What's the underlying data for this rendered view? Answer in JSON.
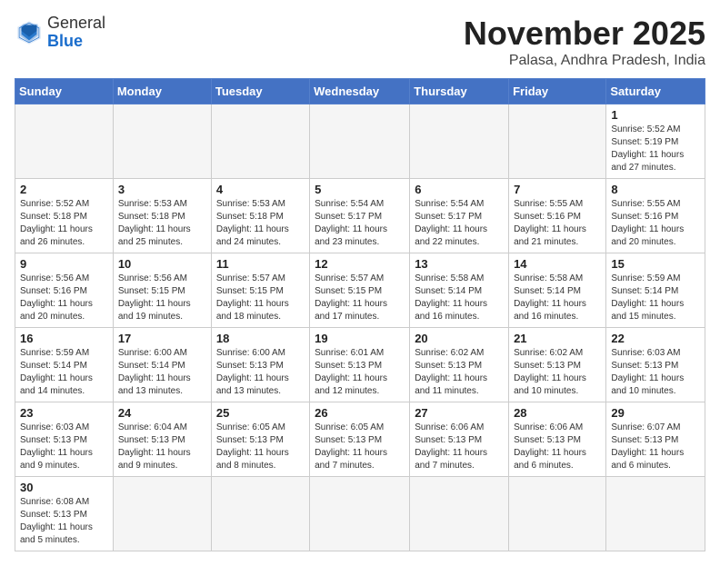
{
  "header": {
    "logo_general": "General",
    "logo_blue": "Blue",
    "month_title": "November 2025",
    "location": "Palasa, Andhra Pradesh, India"
  },
  "weekdays": [
    "Sunday",
    "Monday",
    "Tuesday",
    "Wednesday",
    "Thursday",
    "Friday",
    "Saturday"
  ],
  "weeks": [
    [
      {
        "day": "",
        "info": ""
      },
      {
        "day": "",
        "info": ""
      },
      {
        "day": "",
        "info": ""
      },
      {
        "day": "",
        "info": ""
      },
      {
        "day": "",
        "info": ""
      },
      {
        "day": "",
        "info": ""
      },
      {
        "day": "1",
        "info": "Sunrise: 5:52 AM\nSunset: 5:19 PM\nDaylight: 11 hours and 27 minutes."
      }
    ],
    [
      {
        "day": "2",
        "info": "Sunrise: 5:52 AM\nSunset: 5:18 PM\nDaylight: 11 hours and 26 minutes."
      },
      {
        "day": "3",
        "info": "Sunrise: 5:53 AM\nSunset: 5:18 PM\nDaylight: 11 hours and 25 minutes."
      },
      {
        "day": "4",
        "info": "Sunrise: 5:53 AM\nSunset: 5:18 PM\nDaylight: 11 hours and 24 minutes."
      },
      {
        "day": "5",
        "info": "Sunrise: 5:54 AM\nSunset: 5:17 PM\nDaylight: 11 hours and 23 minutes."
      },
      {
        "day": "6",
        "info": "Sunrise: 5:54 AM\nSunset: 5:17 PM\nDaylight: 11 hours and 22 minutes."
      },
      {
        "day": "7",
        "info": "Sunrise: 5:55 AM\nSunset: 5:16 PM\nDaylight: 11 hours and 21 minutes."
      },
      {
        "day": "8",
        "info": "Sunrise: 5:55 AM\nSunset: 5:16 PM\nDaylight: 11 hours and 20 minutes."
      }
    ],
    [
      {
        "day": "9",
        "info": "Sunrise: 5:56 AM\nSunset: 5:16 PM\nDaylight: 11 hours and 20 minutes."
      },
      {
        "day": "10",
        "info": "Sunrise: 5:56 AM\nSunset: 5:15 PM\nDaylight: 11 hours and 19 minutes."
      },
      {
        "day": "11",
        "info": "Sunrise: 5:57 AM\nSunset: 5:15 PM\nDaylight: 11 hours and 18 minutes."
      },
      {
        "day": "12",
        "info": "Sunrise: 5:57 AM\nSunset: 5:15 PM\nDaylight: 11 hours and 17 minutes."
      },
      {
        "day": "13",
        "info": "Sunrise: 5:58 AM\nSunset: 5:14 PM\nDaylight: 11 hours and 16 minutes."
      },
      {
        "day": "14",
        "info": "Sunrise: 5:58 AM\nSunset: 5:14 PM\nDaylight: 11 hours and 16 minutes."
      },
      {
        "day": "15",
        "info": "Sunrise: 5:59 AM\nSunset: 5:14 PM\nDaylight: 11 hours and 15 minutes."
      }
    ],
    [
      {
        "day": "16",
        "info": "Sunrise: 5:59 AM\nSunset: 5:14 PM\nDaylight: 11 hours and 14 minutes."
      },
      {
        "day": "17",
        "info": "Sunrise: 6:00 AM\nSunset: 5:14 PM\nDaylight: 11 hours and 13 minutes."
      },
      {
        "day": "18",
        "info": "Sunrise: 6:00 AM\nSunset: 5:13 PM\nDaylight: 11 hours and 13 minutes."
      },
      {
        "day": "19",
        "info": "Sunrise: 6:01 AM\nSunset: 5:13 PM\nDaylight: 11 hours and 12 minutes."
      },
      {
        "day": "20",
        "info": "Sunrise: 6:02 AM\nSunset: 5:13 PM\nDaylight: 11 hours and 11 minutes."
      },
      {
        "day": "21",
        "info": "Sunrise: 6:02 AM\nSunset: 5:13 PM\nDaylight: 11 hours and 10 minutes."
      },
      {
        "day": "22",
        "info": "Sunrise: 6:03 AM\nSunset: 5:13 PM\nDaylight: 11 hours and 10 minutes."
      }
    ],
    [
      {
        "day": "23",
        "info": "Sunrise: 6:03 AM\nSunset: 5:13 PM\nDaylight: 11 hours and 9 minutes."
      },
      {
        "day": "24",
        "info": "Sunrise: 6:04 AM\nSunset: 5:13 PM\nDaylight: 11 hours and 9 minutes."
      },
      {
        "day": "25",
        "info": "Sunrise: 6:05 AM\nSunset: 5:13 PM\nDaylight: 11 hours and 8 minutes."
      },
      {
        "day": "26",
        "info": "Sunrise: 6:05 AM\nSunset: 5:13 PM\nDaylight: 11 hours and 7 minutes."
      },
      {
        "day": "27",
        "info": "Sunrise: 6:06 AM\nSunset: 5:13 PM\nDaylight: 11 hours and 7 minutes."
      },
      {
        "day": "28",
        "info": "Sunrise: 6:06 AM\nSunset: 5:13 PM\nDaylight: 11 hours and 6 minutes."
      },
      {
        "day": "29",
        "info": "Sunrise: 6:07 AM\nSunset: 5:13 PM\nDaylight: 11 hours and 6 minutes."
      }
    ],
    [
      {
        "day": "30",
        "info": "Sunrise: 6:08 AM\nSunset: 5:13 PM\nDaylight: 11 hours and 5 minutes."
      },
      {
        "day": "",
        "info": ""
      },
      {
        "day": "",
        "info": ""
      },
      {
        "day": "",
        "info": ""
      },
      {
        "day": "",
        "info": ""
      },
      {
        "day": "",
        "info": ""
      },
      {
        "day": "",
        "info": ""
      }
    ]
  ]
}
